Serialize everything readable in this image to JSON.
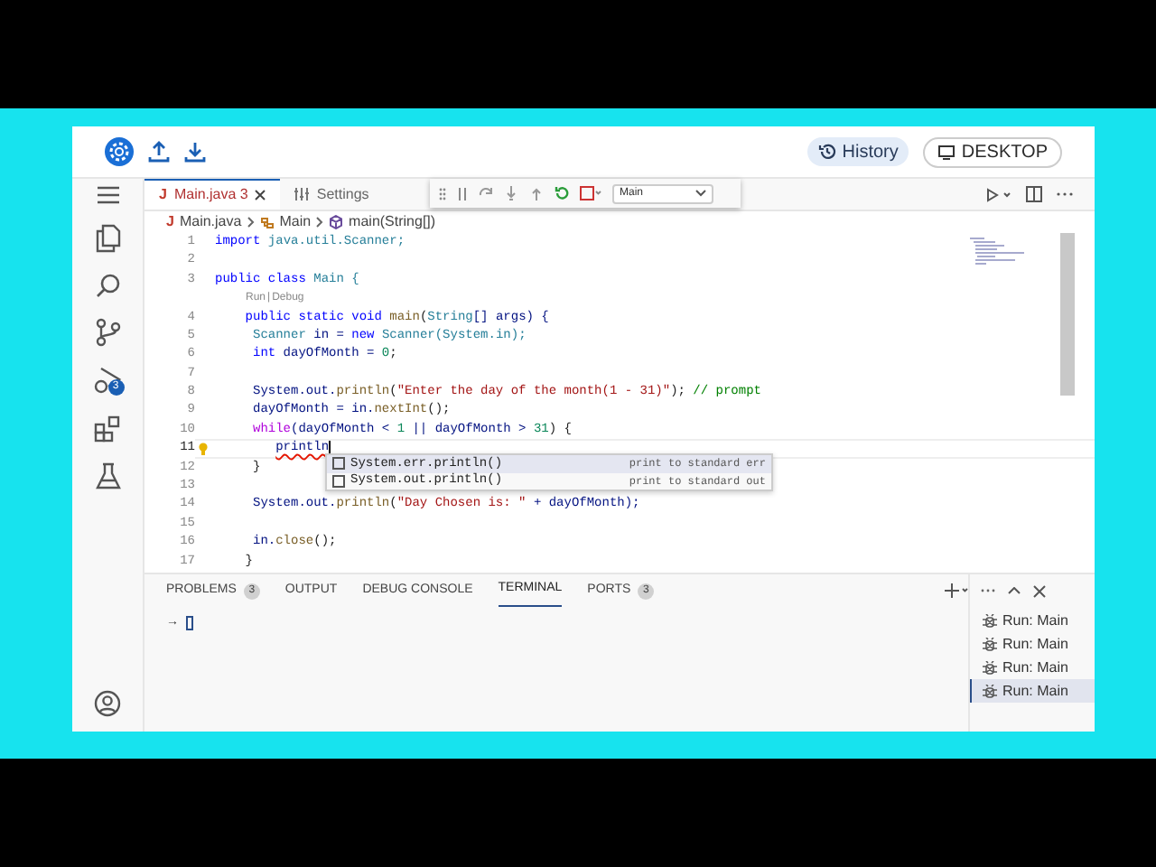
{
  "header": {
    "history_label": "History",
    "desktop_label": "DESKTOP"
  },
  "activity_bar": {
    "debug_badge": "3"
  },
  "editor_tabs": [
    {
      "label": "Main.java",
      "badge": "3",
      "selected": true,
      "kind": "java",
      "icon_letter": "J"
    },
    {
      "label": "Settings",
      "selected": false,
      "kind": "settings"
    }
  ],
  "debug_toolbar": {
    "config": "Main"
  },
  "breadcrumb": [
    {
      "label": "Main.java",
      "kind": "file",
      "icon_letter": "J"
    },
    {
      "label": "Main",
      "kind": "class"
    },
    {
      "label": "main(String[])",
      "kind": "method"
    }
  ],
  "code_lines": [
    {
      "kind": "code",
      "number": "1",
      "current": false,
      "tokens": [
        {
          "text": "import",
          "kind": "kw"
        },
        {
          "text": " java.util.Scanner;",
          "kind": "type"
        }
      ]
    },
    {
      "kind": "code",
      "number": "2",
      "current": false
    },
    {
      "kind": "code",
      "number": "3",
      "current": false,
      "tokens": [
        {
          "text": "public class",
          "kind": "kw"
        },
        {
          "text": " Main {",
          "kind": "type"
        }
      ]
    },
    {
      "kind": "codelens",
      "links": [
        "Run",
        "Debug"
      ],
      "separator": "|"
    },
    {
      "kind": "code",
      "number": "4",
      "current": false,
      "tokens": [
        {
          "text": "    public static void",
          "kind": "kw"
        },
        {
          "text": " main",
          "kind": "fn"
        },
        {
          "text": "(",
          "kind": "plain"
        },
        {
          "text": "String",
          "kind": "type"
        },
        {
          "text": "[] args) {",
          "kind": "var"
        }
      ]
    },
    {
      "kind": "code",
      "number": "5",
      "current": false,
      "tokens": [
        {
          "text": "     Scanner",
          "kind": "type"
        },
        {
          "text": " in = ",
          "kind": "var"
        },
        {
          "text": "new",
          "kind": "kw"
        },
        {
          "text": " Scanner(System.in);",
          "kind": "type"
        }
      ]
    },
    {
      "kind": "code",
      "number": "6",
      "current": false,
      "tokens": [
        {
          "text": "     int",
          "kind": "kw"
        },
        {
          "text": " dayOfMonth = ",
          "kind": "var"
        },
        {
          "text": "0",
          "kind": "num"
        },
        {
          "text": ";",
          "kind": "plain"
        }
      ]
    },
    {
      "kind": "code",
      "number": "7",
      "current": false
    },
    {
      "kind": "code",
      "number": "8",
      "current": false,
      "tokens": [
        {
          "text": "     System.out.",
          "kind": "var"
        },
        {
          "text": "println",
          "kind": "fn"
        },
        {
          "text": "(",
          "kind": "plain"
        },
        {
          "text": "\"Enter the day of the month(1 - 31)\"",
          "kind": "str"
        },
        {
          "text": "); ",
          "kind": "plain"
        },
        {
          "text": "// prompt",
          "kind": "comment"
        }
      ]
    },
    {
      "kind": "code",
      "number": "9",
      "current": false,
      "tokens": [
        {
          "text": "     dayOfMonth = in.",
          "kind": "var"
        },
        {
          "text": "nextInt",
          "kind": "fn"
        },
        {
          "text": "();",
          "kind": "plain"
        }
      ]
    },
    {
      "kind": "code",
      "number": "10",
      "current": false,
      "tokens": [
        {
          "text": "     while",
          "kind": "ctrl"
        },
        {
          "text": "(dayOfMonth < ",
          "kind": "var"
        },
        {
          "text": "1",
          "kind": "num"
        },
        {
          "text": " || dayOfMonth > ",
          "kind": "var"
        },
        {
          "text": "31",
          "kind": "num"
        },
        {
          "text": ") {",
          "kind": "plain"
        }
      ]
    },
    {
      "kind": "code",
      "number": "11",
      "current": true,
      "lightbulb": true,
      "tokens": [
        {
          "text": "        println",
          "kind": "error"
        }
      ]
    },
    {
      "kind": "code",
      "number": "12",
      "current": false,
      "tokens": [
        {
          "text": "     }",
          "kind": "plain"
        }
      ]
    },
    {
      "kind": "code",
      "number": "13",
      "current": false
    },
    {
      "kind": "code",
      "number": "14",
      "current": false,
      "tokens": [
        {
          "text": "     System.out.",
          "kind": "var"
        },
        {
          "text": "println",
          "kind": "fn"
        },
        {
          "text": "(",
          "kind": "plain"
        },
        {
          "text": "\"Day Chosen is: \"",
          "kind": "str"
        },
        {
          "text": " + dayOfMonth);",
          "kind": "var"
        }
      ]
    },
    {
      "kind": "code",
      "number": "15",
      "current": false
    },
    {
      "kind": "code",
      "number": "16",
      "current": false,
      "tokens": [
        {
          "text": "     in.",
          "kind": "var"
        },
        {
          "text": "close",
          "kind": "fn"
        },
        {
          "text": "();",
          "kind": "plain"
        }
      ]
    },
    {
      "kind": "code",
      "number": "17",
      "current": false,
      "tokens": [
        {
          "text": "    }",
          "kind": "plain"
        }
      ]
    }
  ],
  "suggestions": [
    {
      "label": "System.err.println()",
      "detail": "print to standard err",
      "selected": true
    },
    {
      "label": "System.out.println()",
      "detail": "print to standard out",
      "selected": false
    }
  ],
  "panel_tabs": [
    {
      "label": "PROBLEMS",
      "badge": "3",
      "selected": false
    },
    {
      "label": "OUTPUT",
      "selected": false
    },
    {
      "label": "DEBUG CONSOLE",
      "selected": false
    },
    {
      "label": "TERMINAL",
      "selected": true
    },
    {
      "label": "PORTS",
      "badge": "3",
      "selected": false
    }
  ],
  "terminal": {
    "prompt": "→"
  },
  "terminals": [
    {
      "label": "Run: Main",
      "selected": false
    },
    {
      "label": "Run: Main",
      "selected": false
    },
    {
      "label": "Run: Main",
      "selected": false
    },
    {
      "label": "Run: Main",
      "selected": true
    }
  ]
}
